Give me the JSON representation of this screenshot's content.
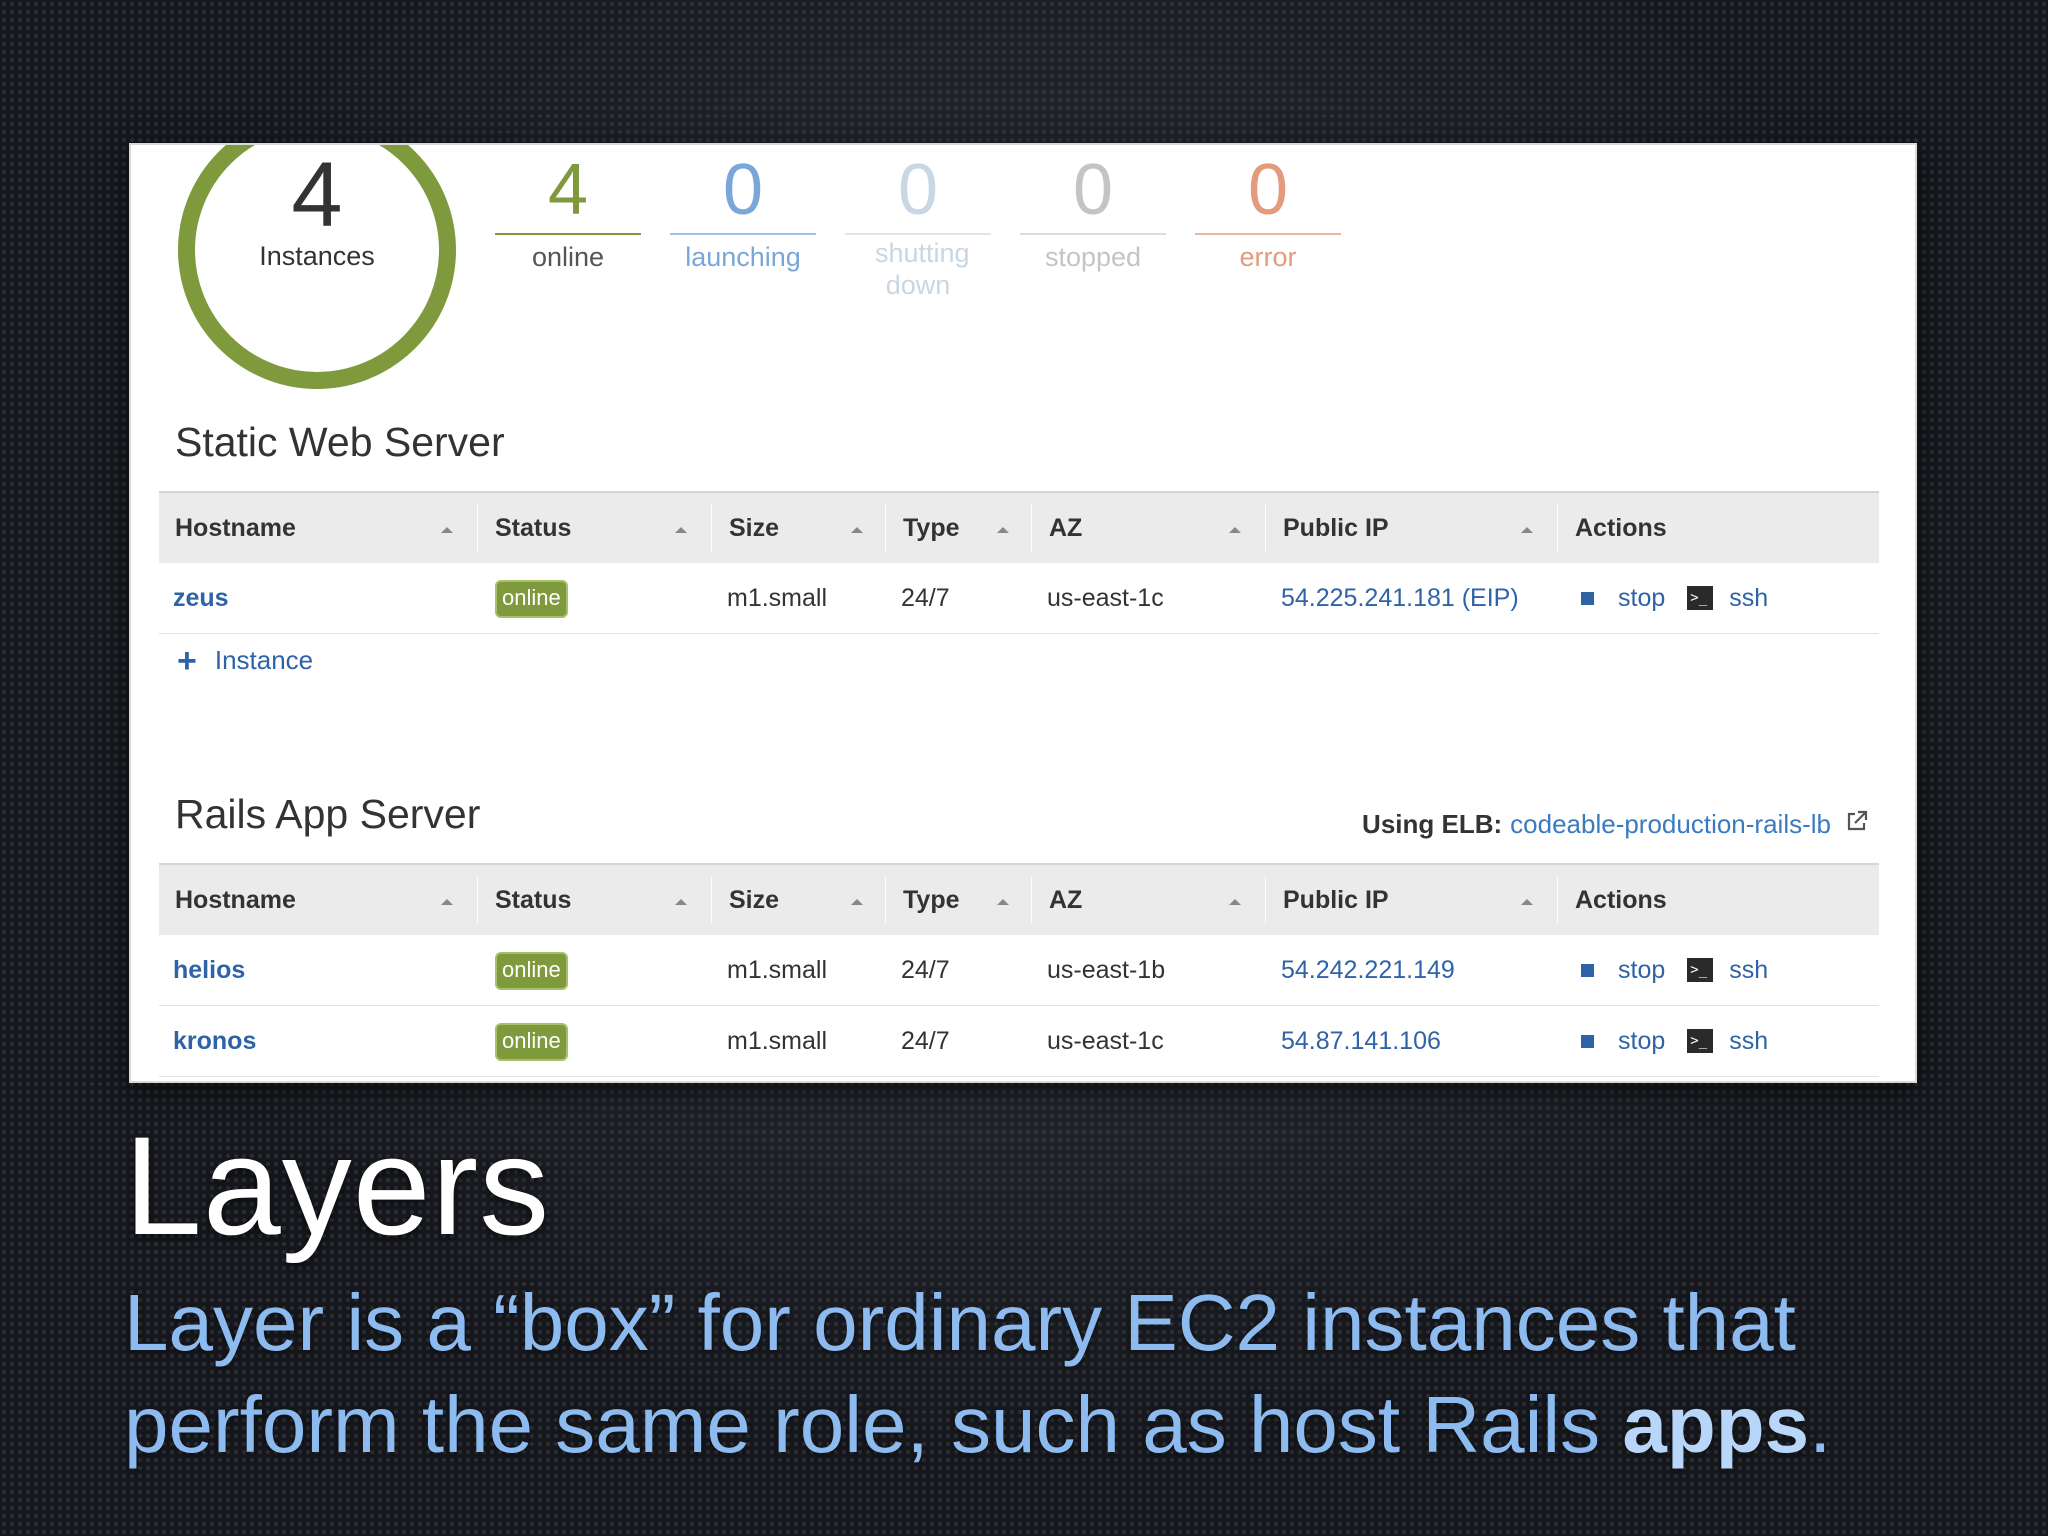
{
  "summary": {
    "total": "4",
    "total_label": "Instances",
    "stats": [
      {
        "value": "4",
        "label": "online",
        "color": "#7e9a3c"
      },
      {
        "value": "0",
        "label": "launching",
        "color": "#7aa6d8"
      },
      {
        "value": "0",
        "label": "shutting down",
        "color": "#c9d6e3"
      },
      {
        "value": "0",
        "label": "stopped",
        "color": "#c4c4c4"
      },
      {
        "value": "0",
        "label": "error",
        "color": "#e39b7c"
      }
    ]
  },
  "columns": [
    "Hostname",
    "Status",
    "Size",
    "Type",
    "AZ",
    "Public IP",
    "Actions"
  ],
  "layers": [
    {
      "title": "Static Web Server",
      "add_label": "Instance",
      "rows": [
        {
          "host": "zeus",
          "status": "online",
          "size": "m1.small",
          "type": "24/7",
          "az": "us-east-1c",
          "ip": "54.225.241.181 (EIP)",
          "stop": "stop",
          "ssh": "ssh"
        }
      ]
    },
    {
      "title": "Rails App Server",
      "elb_label": "Using ELB:",
      "elb_link": "codeable-production-rails-lb",
      "rows": [
        {
          "host": "helios",
          "status": "online",
          "size": "m1.small",
          "type": "24/7",
          "az": "us-east-1b",
          "ip": "54.242.221.149",
          "stop": "stop",
          "ssh": "ssh"
        },
        {
          "host": "kronos",
          "status": "online",
          "size": "m1.small",
          "type": "24/7",
          "az": "us-east-1c",
          "ip": "54.87.141.106",
          "stop": "stop",
          "ssh": "ssh"
        }
      ]
    }
  ],
  "slide": {
    "title": "Layers",
    "body_text": "Layer is a “box” for ordinary EC2 instances that perform the same role, such as host Rails ",
    "body_bold": "apps",
    "body_end": "."
  },
  "icons": {
    "ssh": ">_"
  }
}
